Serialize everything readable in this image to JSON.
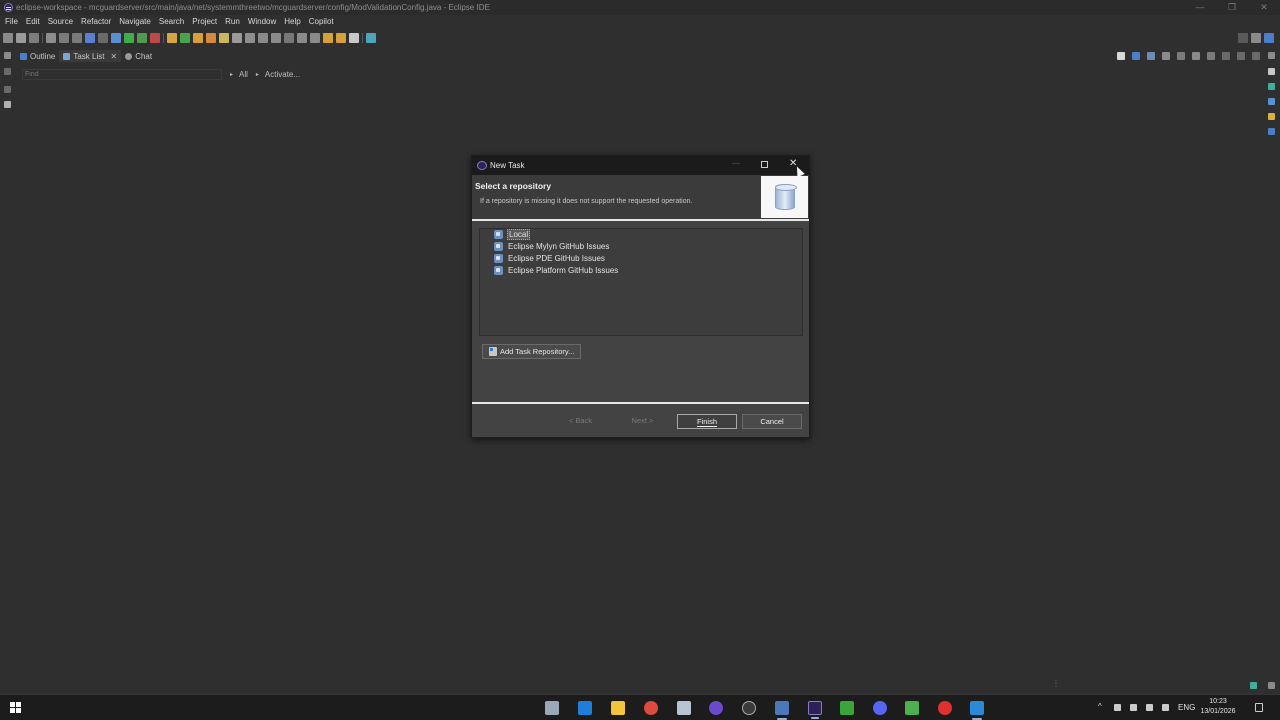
{
  "window": {
    "title": "eclipse-workspace - mcguardserver/src/main/java/net/systemmthreetwo/mcguardserver/config/ModValidationConfig.java - Eclipse IDE",
    "controls": [
      "—",
      "❐",
      "✕"
    ]
  },
  "menu": [
    "File",
    "Edit",
    "Source",
    "Refactor",
    "Navigate",
    "Search",
    "Project",
    "Run",
    "Window",
    "Help",
    "Copilot"
  ],
  "views": {
    "tabs": [
      {
        "label": "Outline"
      },
      {
        "label": "Task List",
        "active": true
      },
      {
        "label": "Chat"
      }
    ],
    "close_glyph": "✕"
  },
  "tasklist": {
    "find_placeholder": "Find",
    "filter_all": "All",
    "activate": "Activate..."
  },
  "dialog": {
    "title": "New Task",
    "heading": "Select a repository",
    "description": "If a repository is missing it does not support the requested operation.",
    "repositories": [
      "Local",
      "Eclipse Mylyn GitHub Issues",
      "Eclipse PDE GitHub Issues",
      "Eclipse Platform GitHub Issues"
    ],
    "selected_repository": "Local",
    "add_repository": "Add Task Repository...",
    "buttons": {
      "back": "< Back",
      "next": "Next >",
      "finish": "Finish",
      "cancel": "Cancel"
    },
    "close_glyph": "✕",
    "minimize_glyph": "—"
  },
  "taskbar": {
    "language": "ENG",
    "time": "10:23",
    "date": "13/01/2026",
    "tray_chevron": "^"
  },
  "status": {
    "grip": "⋮"
  },
  "colors": {
    "background": "#2f2f2f",
    "dialog": "#434343",
    "dialog_titlebar": "#1b1b1b",
    "taskbar": "#1c1c1c"
  }
}
